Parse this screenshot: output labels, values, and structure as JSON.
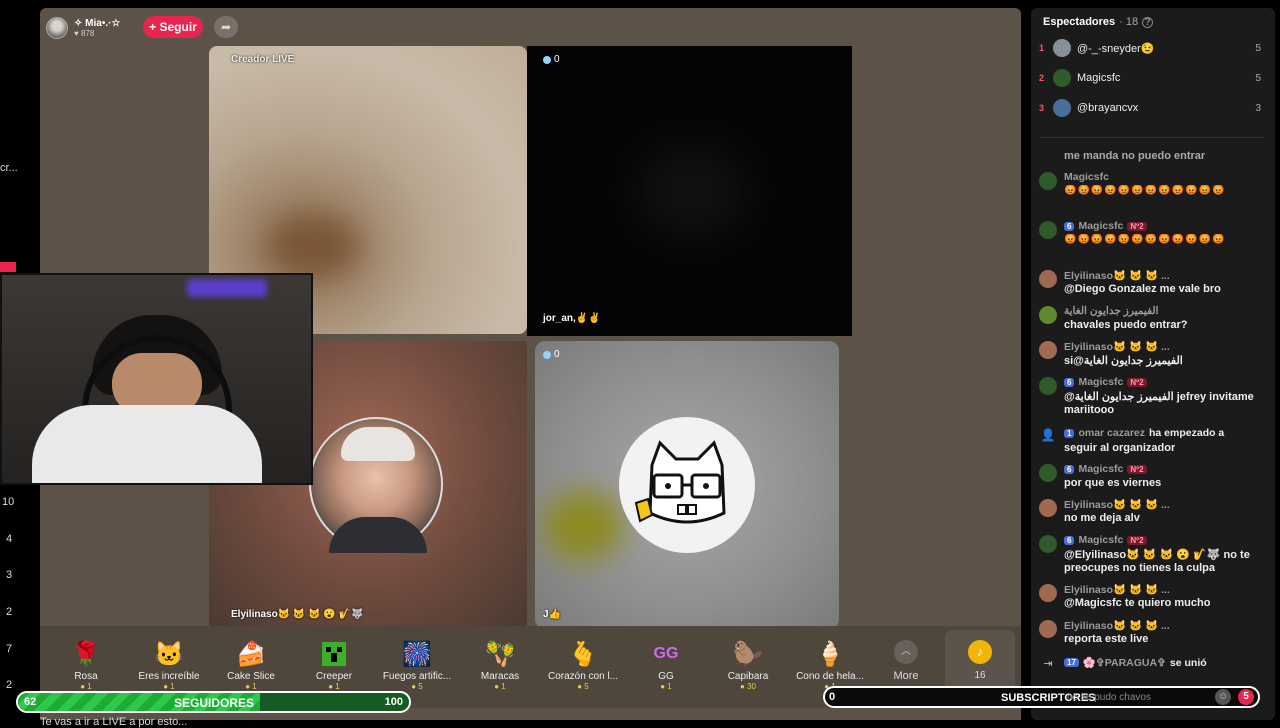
{
  "host": {
    "name": "✧ Mia•.·☆",
    "likes": "878",
    "follow_label": "+ Seguir"
  },
  "tiles": {
    "creator_label": "Creador LIVE",
    "top_right_count": "0",
    "top_right_name": "jor_an,✌️✌️",
    "bottom_left_name": "Elyilinaso🐱 🐱 🐱 😮 🎷🐺",
    "bottom_right_count": "0",
    "bottom_right_name": "J👍"
  },
  "side_numbers": [
    "10",
    "4",
    "3",
    "2",
    "7",
    "2"
  ],
  "side_partial": "cr...",
  "gifts": [
    {
      "name": "Rosa",
      "cost": "1",
      "icon": "🌹"
    },
    {
      "name": "Eres increíble",
      "cost": "1",
      "icon": "🐱"
    },
    {
      "name": "Cake Slice",
      "cost": "1",
      "icon": "🍰"
    },
    {
      "name": "Creeper",
      "cost": "1",
      "icon": "👾"
    },
    {
      "name": "Fuegos artific...",
      "cost": "5",
      "icon": "🎆"
    },
    {
      "name": "Maracas",
      "cost": "1",
      "icon": "🪇"
    },
    {
      "name": "Corazón con l...",
      "cost": "5",
      "icon": "🫰"
    },
    {
      "name": "GG",
      "cost": "1",
      "icon": "GG"
    },
    {
      "name": "Capibara",
      "cost": "30",
      "icon": "🦫"
    },
    {
      "name": "Cono de hela...",
      "cost": "1",
      "icon": "🍦"
    }
  ],
  "more_label": "More",
  "tiktok_count": "16",
  "followers_bar": {
    "current": "62",
    "label": "SEGUIDORES",
    "goal": "100",
    "progress": 0.62
  },
  "subscribers_bar": {
    "current": "0",
    "label": "SUBSCRIPTORES",
    "goal": "5"
  },
  "bottom_ticker": "Te vas a ir a LIVE a por esto...",
  "panel": {
    "viewers_title": "Espectadores",
    "viewers_count": "· 18",
    "viewers": [
      {
        "rank": "1",
        "name": "@-_-sneyder😉",
        "score": "5"
      },
      {
        "rank": "2",
        "name": "Magicsfc",
        "score": "5"
      },
      {
        "rank": "3",
        "name": "@brayancvx",
        "score": "3"
      }
    ],
    "messages": [
      {
        "user": "",
        "text": "me manda no puedo entrar"
      },
      {
        "user": "Magicsfc",
        "text": "😡😡😡😡😡😡😡😡😡😡😡😡"
      },
      {
        "user": "Magicsfc",
        "level": "6",
        "fan": "Nº2",
        "text": "😡😡😡😡😡😡😡😡😡😡😡😡"
      },
      {
        "user": "Elyilinaso🐱 🐱 🐱 ...",
        "text": "@Diego Gonzalez me vale bro"
      },
      {
        "user": "الفيميرز جدايون الغاية",
        "text": "chavales puedo entrar?"
      },
      {
        "user": "Elyilinaso🐱 🐱 🐱 ...",
        "text": "si@الفيميرز جدايون الغاية"
      },
      {
        "user": "Magicsfc",
        "level": "6",
        "fan": "Nº2",
        "text": "@الفيميرز جدايون الغاية jefrey invitame",
        "text2": "mariitooo"
      },
      {
        "user": "omar cazarez",
        "level": "1",
        "text": "ha empezado a",
        "text2": "seguir al organizador"
      },
      {
        "user": "Magicsfc",
        "level": "6",
        "fan": "Nº2",
        "text": "por que es viernes"
      },
      {
        "user": "Elyilinaso🐱 🐱 🐱 ...",
        "text": "no me deja alv"
      },
      {
        "user": "Magicsfc",
        "level": "6",
        "fan": "Nº2",
        "text": "@Elyilinaso🐱 🐱 🐱 😮 🎷🐺 no te",
        "text2": "preocupes no tienes la culpa"
      },
      {
        "user": "Elyilinaso🐱 🐱 🐱 ...",
        "text": "@Magicsfc te quiero mucho"
      },
      {
        "user": "Elyilinaso🐱 🐱 🐱 ...",
        "text": "reporta este live"
      },
      {
        "user": "🌸✞PARAGUA✞",
        "level": "17",
        "text": "se unió"
      }
    ],
    "input_placeholder": "no se pudo chavos"
  }
}
